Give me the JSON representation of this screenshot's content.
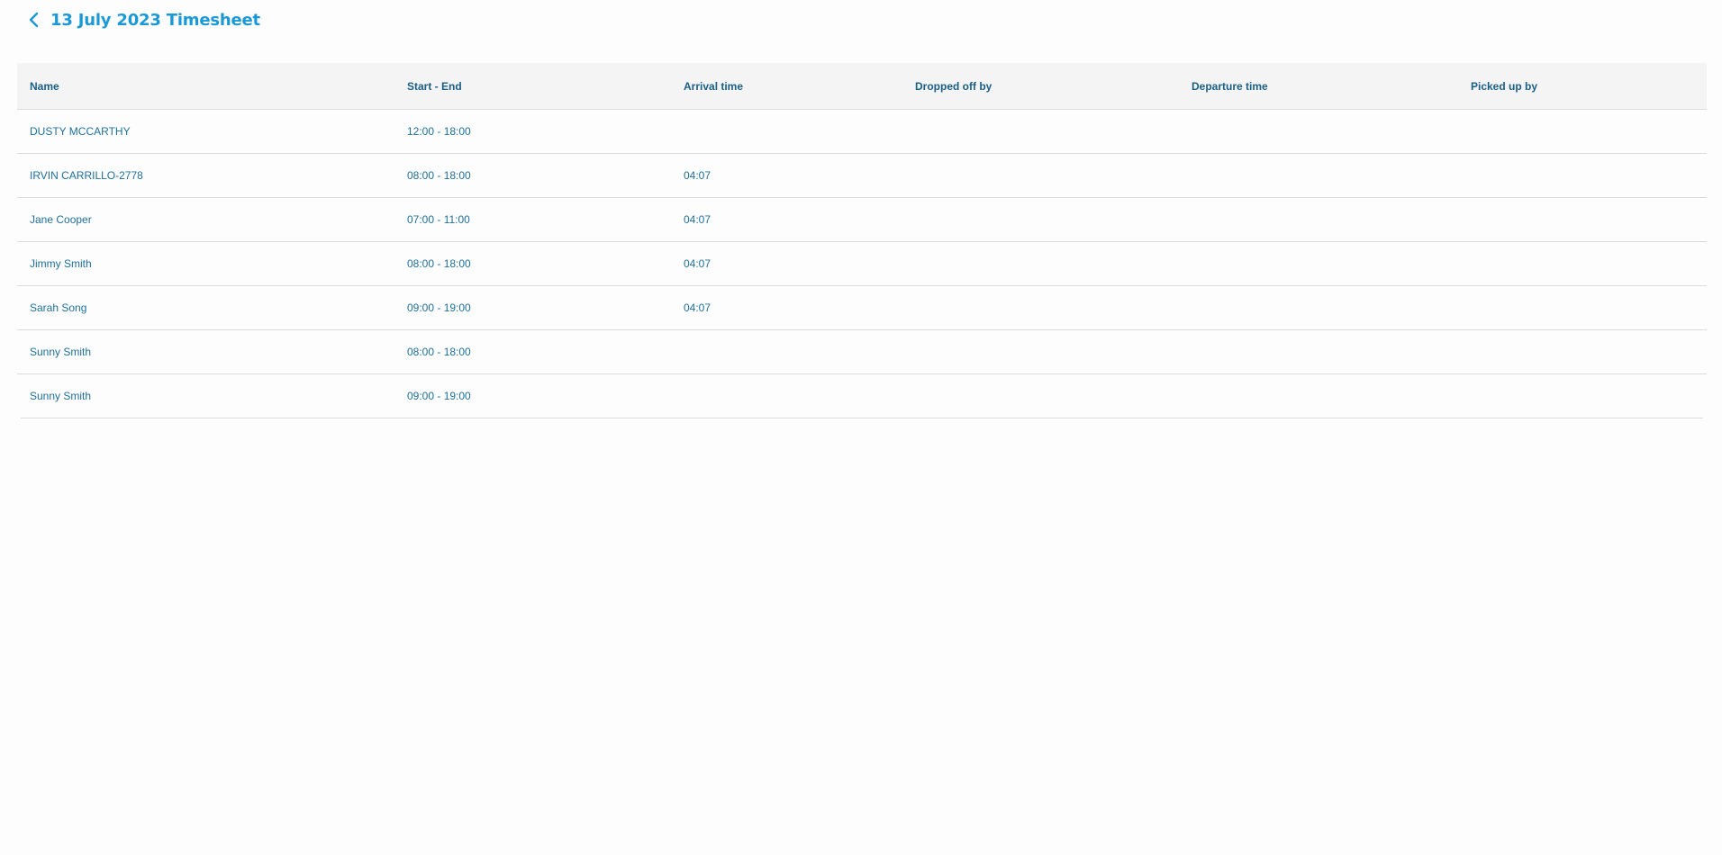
{
  "header": {
    "title": "13 July 2023 Timesheet",
    "back_icon": "chevron-left-icon",
    "accent_color": "#1b98d6"
  },
  "table": {
    "columns": [
      "Name",
      "Start - End",
      "Arrival time",
      "Dropped off by",
      "Departure time",
      "Picked up by"
    ],
    "rows": [
      {
        "name": "DUSTY MCCARTHY",
        "start_end": "12:00 - 18:00",
        "arrival": "",
        "dropped_off_by": "",
        "departure": "",
        "picked_up_by": ""
      },
      {
        "name": "IRVIN CARRILLO-2778",
        "start_end": "08:00 - 18:00",
        "arrival": "04:07",
        "dropped_off_by": "",
        "departure": "",
        "picked_up_by": ""
      },
      {
        "name": "Jane Cooper",
        "start_end": "07:00 - 11:00",
        "arrival": "04:07",
        "dropped_off_by": "",
        "departure": "",
        "picked_up_by": ""
      },
      {
        "name": "Jimmy Smith",
        "start_end": "08:00 - 18:00",
        "arrival": "04:07",
        "dropped_off_by": "",
        "departure": "",
        "picked_up_by": ""
      },
      {
        "name": "Sarah Song",
        "start_end": "09:00 - 19:00",
        "arrival": "04:07",
        "dropped_off_by": "",
        "departure": "",
        "picked_up_by": ""
      },
      {
        "name": "Sunny Smith",
        "start_end": "08:00 - 18:00",
        "arrival": "",
        "dropped_off_by": "",
        "departure": "",
        "picked_up_by": ""
      },
      {
        "name": "Sunny Smith",
        "start_end": "09:00 - 19:00",
        "arrival": "",
        "dropped_off_by": "",
        "departure": "",
        "picked_up_by": ""
      }
    ]
  }
}
